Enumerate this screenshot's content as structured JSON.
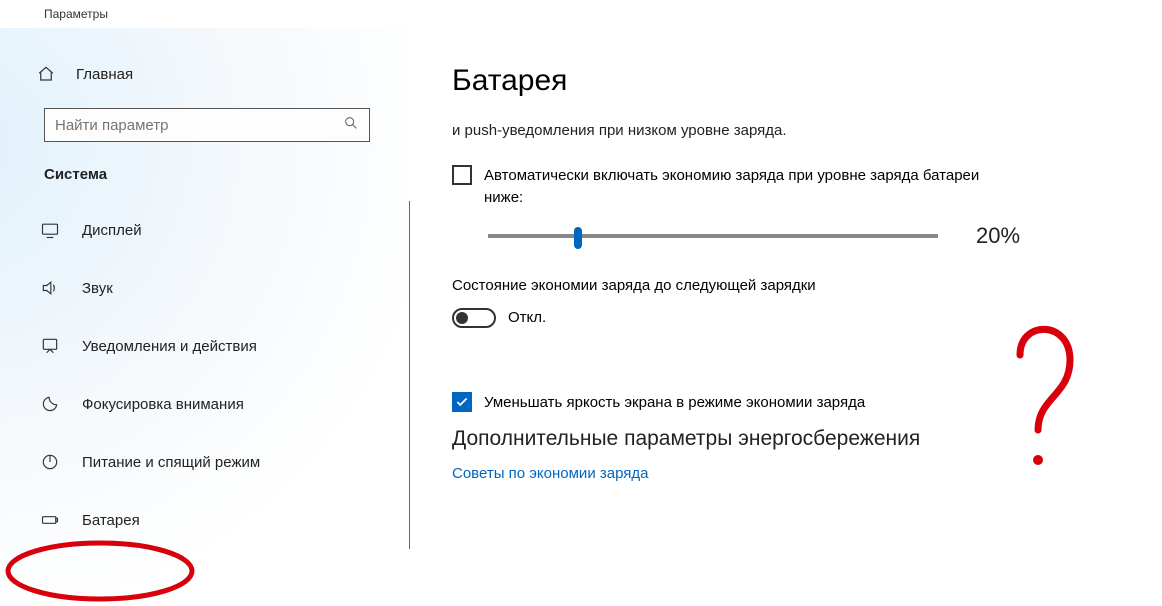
{
  "window": {
    "title": "Параметры"
  },
  "sidebar": {
    "home_label": "Главная",
    "search_placeholder": "Найти параметр",
    "group_title": "Система",
    "items": [
      {
        "label": "Дисплей"
      },
      {
        "label": "Звук"
      },
      {
        "label": "Уведомления и действия"
      },
      {
        "label": "Фокусировка внимания"
      },
      {
        "label": "Питание и спящий режим"
      },
      {
        "label": "Батарея"
      }
    ]
  },
  "main": {
    "heading": "Батарея",
    "subtitle": "и push-уведомления при низком уровне заряда.",
    "auto_saver_checkbox": {
      "checked": false,
      "text": "Автоматически включать экономию заряда при уровне заряда батареи ниже:"
    },
    "slider_value_label": "20%",
    "slider_percent": 20,
    "state_label": "Состояние экономии заряда до следующей зарядки",
    "toggle": {
      "on": false,
      "label": "Откл."
    },
    "dim_checkbox": {
      "checked": true,
      "text": "Уменьшать яркость экрана в режиме экономии заряда"
    },
    "extra_section_heading": "Дополнительные параметры энергосбережения",
    "tips_link": "Советы по экономии заряда"
  },
  "colors": {
    "accent": "#0067c0",
    "annotation": "#d8000a"
  }
}
